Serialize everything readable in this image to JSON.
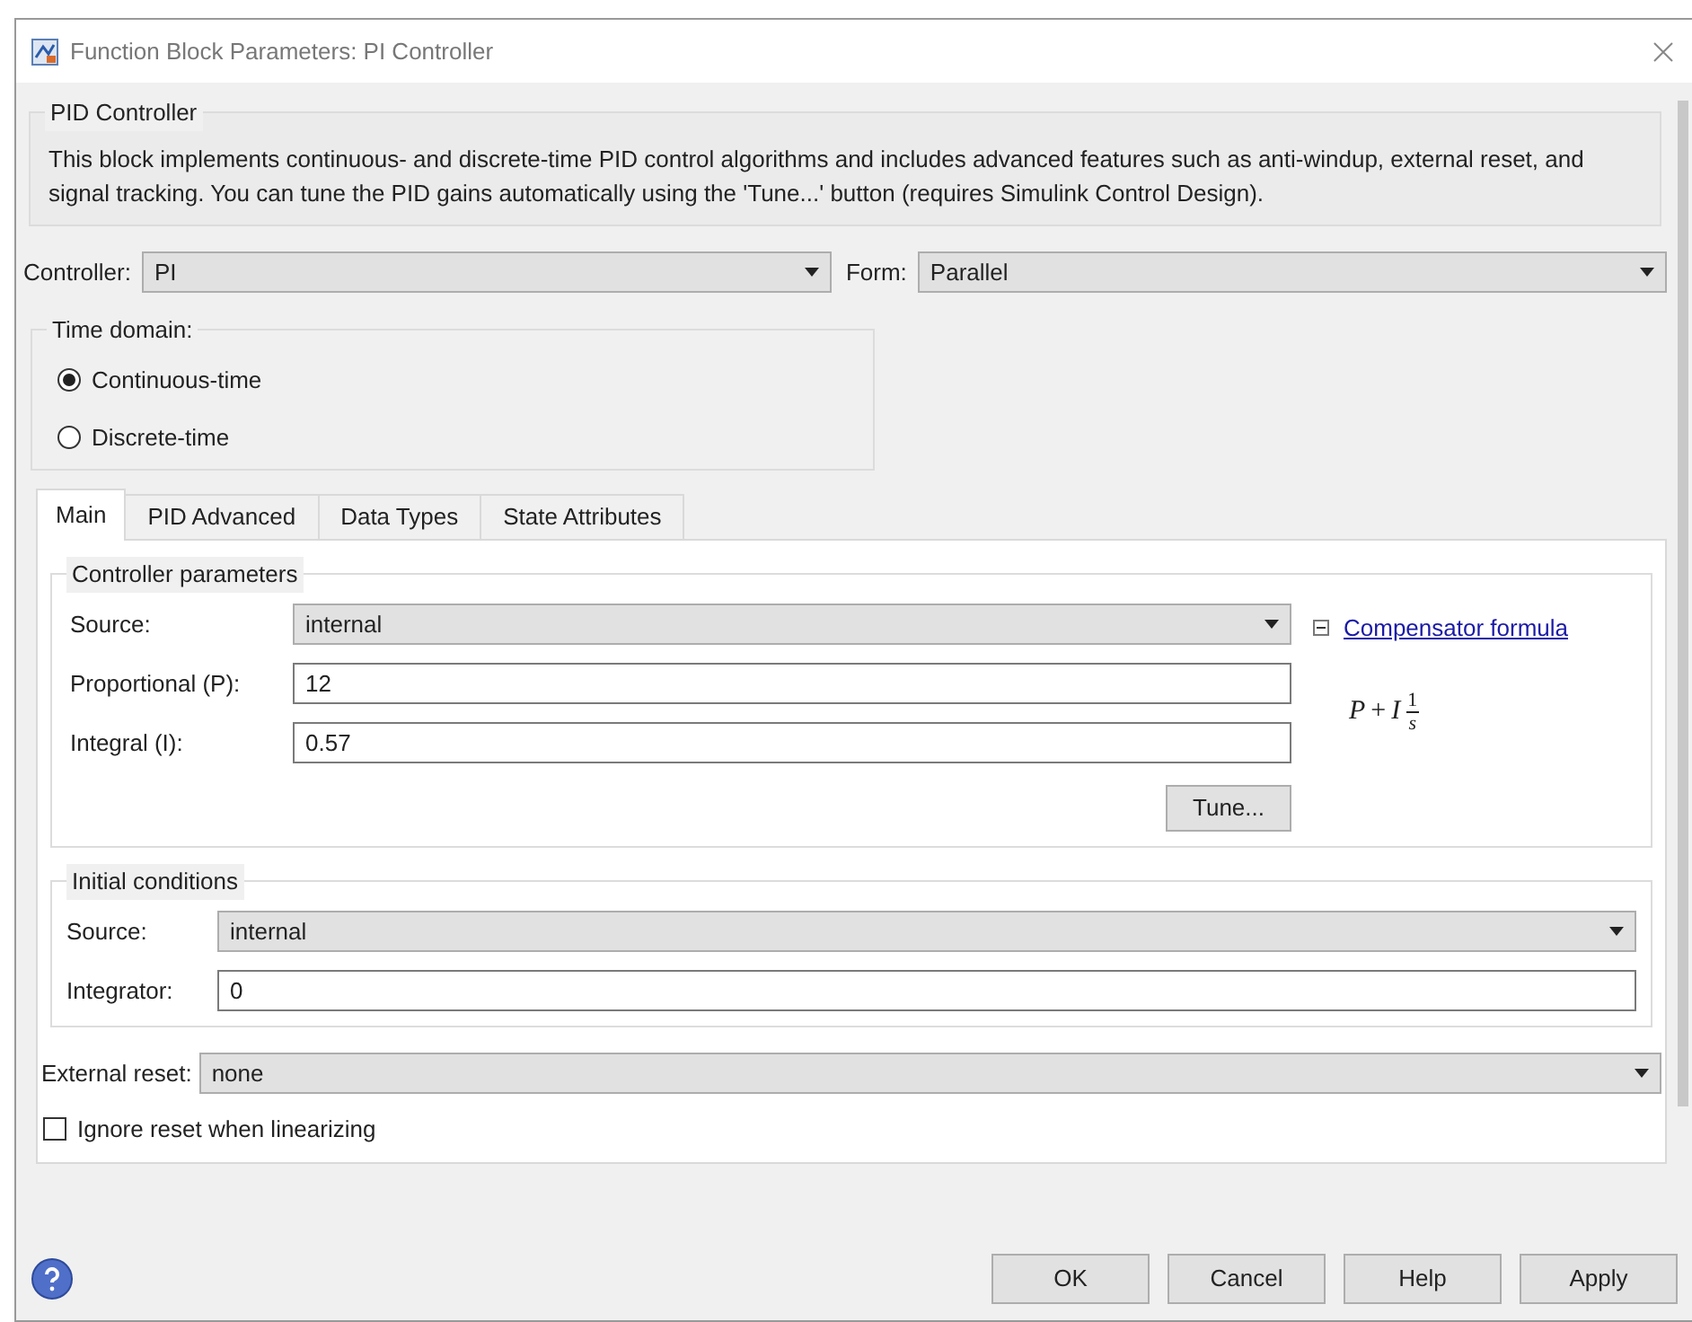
{
  "window": {
    "title": "Function Block Parameters: PI Controller"
  },
  "description": {
    "title": "PID Controller",
    "text": "This block implements continuous- and discrete-time PID control algorithms and includes advanced features such as anti-windup, external reset, and signal tracking. You can tune the PID gains automatically using the 'Tune...' button (requires Simulink Control Design)."
  },
  "controller": {
    "label": "Controller:",
    "value": "PI"
  },
  "form": {
    "label": "Form:",
    "value": "Parallel"
  },
  "time_domain": {
    "title": "Time domain:",
    "options": [
      {
        "label": "Continuous-time",
        "selected": true
      },
      {
        "label": "Discrete-time",
        "selected": false
      }
    ]
  },
  "tabs": [
    {
      "label": "Main",
      "selected": true
    },
    {
      "label": "PID Advanced",
      "selected": false
    },
    {
      "label": "Data Types",
      "selected": false
    },
    {
      "label": "State Attributes",
      "selected": false
    }
  ],
  "controller_parameters": {
    "title": "Controller parameters",
    "fields": [
      {
        "kind": "dropdown",
        "label": "Source:",
        "value": "internal"
      },
      {
        "kind": "text",
        "label": "Proportional (P):",
        "value": "12"
      },
      {
        "kind": "text",
        "label": "Integral (I):",
        "value": "0.57"
      }
    ],
    "expanded": true,
    "link": "Compensator formula",
    "formula": {
      "p": "P",
      "plus": "+",
      "i": "I",
      "numerator": "1",
      "denominator": "s"
    },
    "tune_button": "Tune..."
  },
  "initial_conditions": {
    "title": "Initial conditions",
    "fields": [
      {
        "kind": "dropdown",
        "label": "Source:",
        "value": "internal"
      },
      {
        "kind": "text",
        "label": "Integrator:",
        "value": "0"
      }
    ]
  },
  "external_reset": {
    "label": "External reset:",
    "value": "none"
  },
  "ignore_reset": {
    "label": "Ignore reset when linearizing",
    "checked": false
  },
  "buttons": [
    "OK",
    "Cancel",
    "Help",
    "Apply"
  ]
}
